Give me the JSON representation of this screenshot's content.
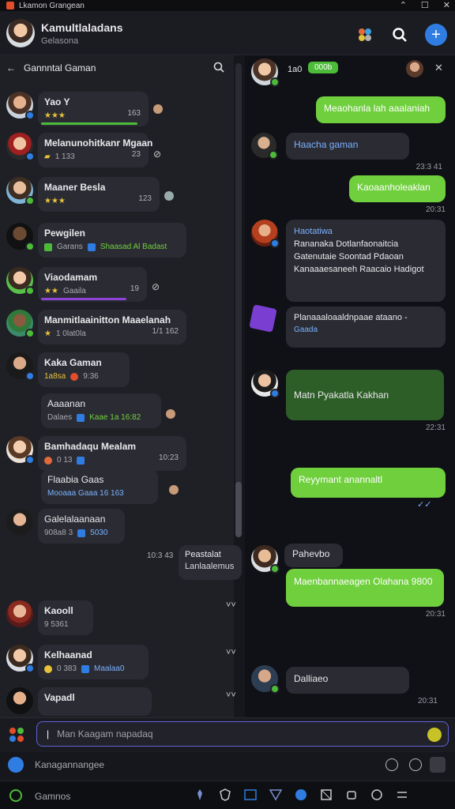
{
  "window": {
    "title": "Lkamon Grangean"
  },
  "header": {
    "name": "Kamultlaladans",
    "subtitle": "Gelasona"
  },
  "left_panel": {
    "title": "Gannntal Gaman"
  },
  "chats": [
    {
      "name": "Yao Y",
      "meta": "",
      "time": "163"
    },
    {
      "name": "Melanunohitkanr Mgaan",
      "meta": "1 133",
      "time": "23"
    },
    {
      "name": "Maaner Besla",
      "meta": "",
      "time": "123"
    },
    {
      "name": "Pewgilen",
      "meta": "Garans",
      "meta2": "Shaasad Al Badast"
    },
    {
      "name": "Viaodamam",
      "meta": "Gaaila",
      "time": "19"
    },
    {
      "name": "Manmitlaainitton Maaelanah",
      "meta": "1 0lat0la",
      "time": "1/1 162"
    },
    {
      "name": "Kaka Gaman",
      "meta": "1a8sa",
      "meta2": "9:36"
    },
    {
      "name": "Aaaanan",
      "meta": "Dalaes",
      "meta2": "Kaae 1a 16:82"
    },
    {
      "name": "Bamhadaqu Mealam",
      "meta": "0 13",
      "time": "10:23"
    },
    {
      "name": "Flaabia Gaas",
      "meta": "Mooaaa Gaaa 16 163"
    },
    {
      "name": "Galelalaanaan",
      "meta": "908a8 3",
      "meta2": "5030"
    },
    {
      "name": "Kaooll",
      "meta": "9 5361"
    },
    {
      "name": "Kelhaanad",
      "meta": "0 383",
      "meta2": "Maalaa0"
    },
    {
      "name": "Vapadl"
    }
  ],
  "bubble_left": {
    "line1": "Peastalat",
    "line2": "Lanlaalemus",
    "time": "10:3 43"
  },
  "conversation": {
    "top_label": "1a0",
    "top_tag": "000b",
    "messages": [
      {
        "text": "Meaohanla lah aaalaniah",
        "time": ""
      },
      {
        "text": "Haacha gaman",
        "time": "23:3 41"
      },
      {
        "text": "Kaoaanholeaklan",
        "time": "20:31"
      },
      {
        "title": "Haotatiwa",
        "text": "Rananaka Dotlanfaonaitcia Gatenutaie Soontad Pdaoan Kanaaaesaneeh Raacaio Hadigot",
        "time": ""
      },
      {
        "text": "Planaaaloaaldnpaae ataano -",
        "tag": "Gaada",
        "time": ""
      },
      {
        "text": "Matn Pyakatla Kakhan",
        "time": "22:31"
      },
      {
        "text": "Reyymant anannaltl",
        "time": ""
      },
      {
        "title": "Pahevbo",
        "text": "Maenbannaeagen Olahana 9800",
        "time": "20:31"
      },
      {
        "text": "Dalliaeo",
        "time": "20:31"
      }
    ]
  },
  "composer": {
    "placeholder": "Man Kaagam napadaq"
  },
  "status": {
    "text": "Kanagannangee"
  },
  "bottom": {
    "label": "Gamnos"
  },
  "colors": {
    "accent": "#2f7de2",
    "outgoing": "#6fcf3c",
    "online": "#4cbb3a",
    "input_border": "#5f62d6"
  }
}
